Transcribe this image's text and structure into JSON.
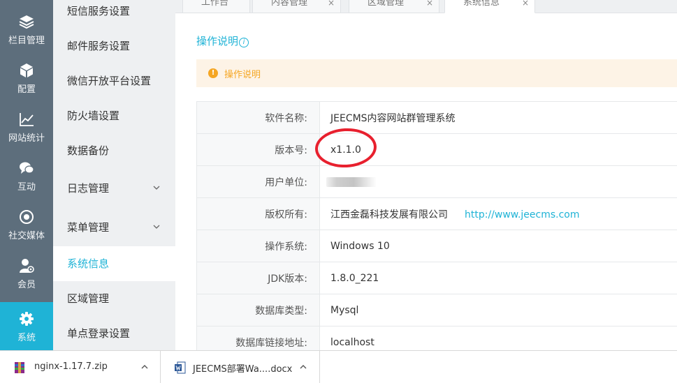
{
  "rail": {
    "items": [
      {
        "label": "栏目管理",
        "icon": "layers-icon"
      },
      {
        "label": "配置",
        "icon": "cube-icon"
      },
      {
        "label": "网站统计",
        "icon": "line-chart-icon"
      },
      {
        "label": "互动",
        "icon": "chat-bubbles-icon"
      },
      {
        "label": "社交媒体",
        "icon": "target-icon"
      },
      {
        "label": "会员",
        "icon": "user-gear-icon"
      },
      {
        "label": "系统",
        "icon": "gear-icon",
        "active": true
      }
    ]
  },
  "submenu": {
    "items": [
      {
        "label": "短信服务设置"
      },
      {
        "label": "邮件服务设置"
      },
      {
        "label": "微信开放平台设置"
      },
      {
        "label": "防火墙设置"
      },
      {
        "label": "数据备份"
      },
      {
        "label": "日志管理",
        "expandable": true
      },
      {
        "label": "菜单管理",
        "expandable": true
      },
      {
        "label": "系统信息",
        "active": true
      },
      {
        "label": "区域管理"
      },
      {
        "label": "单点登录设置"
      }
    ]
  },
  "tabs": [
    {
      "label": "工作台",
      "closable": false
    },
    {
      "label": "内容管理",
      "closable": true,
      "close": "×"
    },
    {
      "label": "区域管理",
      "closable": true,
      "close": "×"
    },
    {
      "label": "系统信息",
      "closable": true,
      "close": "×",
      "active": true
    }
  ],
  "content": {
    "title": "操作说明",
    "info_glyph": "i",
    "notice": "操作说明",
    "warn_glyph": "!",
    "rows": [
      {
        "key": "软件名称:",
        "value": "JEECMS内容网站群管理系统"
      },
      {
        "key": "版本号:",
        "value": "x1.1.0"
      },
      {
        "key": "用户单位:",
        "value": ""
      },
      {
        "key": "版权所有:",
        "value": "江西金磊科技发展有限公司",
        "link": "http://www.jeecms.com"
      },
      {
        "key": "操作系统:",
        "value": "Windows 10"
      },
      {
        "key": "JDK版本:",
        "value": "1.8.0_221"
      },
      {
        "key": "数据库类型:",
        "value": "Mysql"
      },
      {
        "key": "数据库链接地址:",
        "value": "localhost"
      }
    ]
  },
  "downloads": [
    {
      "name": "nginx-1.17.7.zip",
      "icon": "zip-archive-icon"
    },
    {
      "name": "JEECMS部署Wa....docx",
      "icon": "word-document-icon"
    }
  ],
  "colors": {
    "rail_bg": "#5d6e7c",
    "accent": "#1fb3d6",
    "warning": "#f5a623",
    "annotation": "#e8202e"
  }
}
